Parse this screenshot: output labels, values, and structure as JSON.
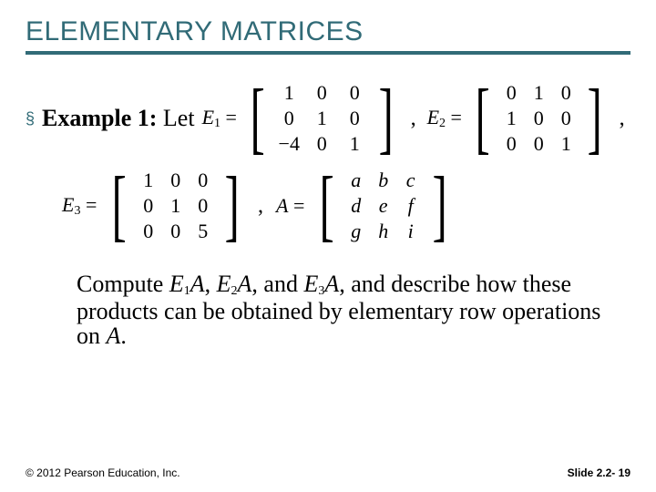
{
  "header": {
    "title": "ELEMENTARY MATRICES"
  },
  "content": {
    "bullet_label": "Example 1:",
    "bullet_let": " Let",
    "E1_label": "E",
    "E1_sub": "1",
    "eq": "=",
    "E1_matrix": [
      "1",
      "0",
      "0",
      "0",
      "1",
      "0",
      "−4",
      "0",
      "1"
    ],
    "sep1": ",",
    "E2_label": "E",
    "E2_sub": "2",
    "E2_matrix": [
      "0",
      "1",
      "0",
      "1",
      "0",
      "0",
      "0",
      "0",
      "1"
    ],
    "sep2": ",",
    "E3_label": "E",
    "E3_sub": "3",
    "E3_matrix": [
      "1",
      "0",
      "0",
      "0",
      "1",
      "0",
      "0",
      "0",
      "5"
    ],
    "sep3": ",",
    "A_label": "A",
    "A_matrix": [
      "a",
      "b",
      "c",
      "d",
      "e",
      "f",
      "g",
      "h",
      "i"
    ],
    "body_pre": "Compute ",
    "p1": "E",
    "p1s": "1",
    "p1A": "A",
    "p_c1": ", ",
    "p2": "E",
    "p2s": "2",
    "p2A": "A",
    "p_c2": ", and ",
    "p3": "E",
    "p3s": "3",
    "p3A": "A",
    "body_post": ", and describe how these products can be obtained by elementary row operations on ",
    "A_final": "A",
    "period": "."
  },
  "footer": {
    "left": "© 2012 Pearson Education, Inc.",
    "right_label": "Slide 2.2- ",
    "right_num": "19"
  }
}
